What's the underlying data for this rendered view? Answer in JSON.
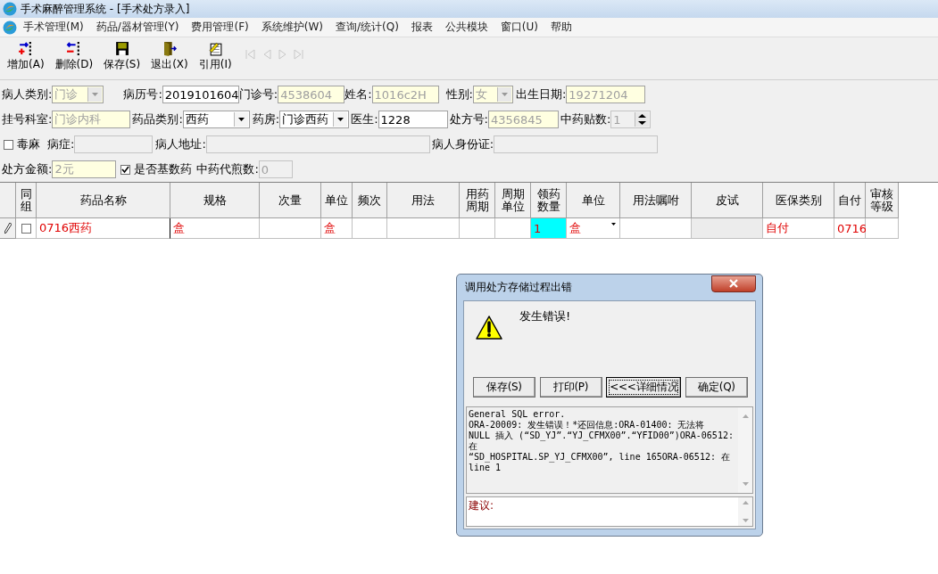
{
  "window": {
    "title": "手术麻醉管理系统 - [手术处方录入]"
  },
  "menu": [
    "手术管理(M)",
    "药品/器材管理(Y)",
    "费用管理(F)",
    "系统维护(W)",
    "查询/统计(Q)",
    "报表",
    "公共模块",
    "窗口(U)",
    "帮助"
  ],
  "toolbar": [
    {
      "kind": "add",
      "label": "增加(A)"
    },
    {
      "kind": "delete",
      "label": "删除(D)"
    },
    {
      "kind": "save",
      "label": "保存(S)"
    },
    {
      "kind": "exit",
      "label": "退出(X)"
    },
    {
      "kind": "cite",
      "label": "引用(I)"
    }
  ],
  "navigator": [
    {
      "kind": "first",
      "disabled": true
    },
    {
      "kind": "prev",
      "disabled": true
    },
    {
      "kind": "next",
      "disabled": true
    },
    {
      "kind": "last",
      "disabled": true
    }
  ],
  "form_rows": [
    [
      {
        "kind": "combo",
        "label": "病人类别:",
        "value": "门诊",
        "readonly": true,
        "disabled": false
      },
      {
        "kind": "text",
        "label": "病历号:",
        "value": "2019101604",
        "readonly": false,
        "disabled": false
      },
      {
        "kind": "text",
        "label": "门诊号:",
        "value": "4538604",
        "readonly": true,
        "disabled": false
      },
      {
        "kind": "text",
        "label": "姓名:",
        "value": "1016c2H",
        "readonly": true,
        "disabled": false
      },
      {
        "kind": "combo",
        "label": "性别:",
        "value": "女",
        "readonly": true,
        "disabled": false
      },
      {
        "kind": "text",
        "label": "出生日期:",
        "value": "19271204",
        "readonly": true,
        "disabled": false
      }
    ],
    [
      {
        "kind": "text",
        "label": "挂号科室:",
        "value": "门诊内科",
        "readonly": true,
        "disabled": false
      },
      {
        "kind": "combo",
        "label": "药品类别:",
        "value": "西药",
        "readonly": false,
        "disabled": false
      },
      {
        "kind": "combo",
        "label": "药房:",
        "value": "门诊西药",
        "readonly": false,
        "disabled": false
      },
      {
        "kind": "text",
        "label": "医生:",
        "value": "1228",
        "readonly": false,
        "disabled": false
      },
      {
        "kind": "text",
        "label": "处方号:",
        "value": "4356845",
        "readonly": true,
        "disabled": false
      },
      {
        "kind": "spin",
        "label": "中药贴数:",
        "value": "1",
        "readonly": false,
        "disabled": true
      }
    ],
    [
      {
        "kind": "checkbox",
        "label": "毒麻",
        "checked": false
      },
      {
        "kind": "text",
        "label": "病症:",
        "readonly": false,
        "disabled": true
      },
      {
        "kind": "text",
        "label": "病人地址:",
        "readonly": false,
        "disabled": true
      },
      {
        "kind": "text",
        "label": "病人身份证:",
        "readonly": false,
        "disabled": true
      }
    ],
    [
      {
        "kind": "text",
        "label": "处方金额:",
        "value": "2元",
        "readonly": true,
        "disabled": false
      },
      {
        "kind": "checkbox",
        "label": "是否基数药",
        "checked": true
      },
      {
        "kind": "text",
        "label": "中药代煎数:",
        "value": "0",
        "readonly": false,
        "disabled": true
      }
    ]
  ],
  "grid": {
    "columns": [
      "同组",
      "药品名称",
      "规格",
      "次量",
      "单位",
      "频次",
      "用法",
      "用药周期",
      "周期单位",
      "领药数量",
      "单位",
      "用法嘱咐",
      "皮试",
      "医保类别",
      "自付",
      "审核等级"
    ],
    "rows": [
      {
        "editing": true,
        "cells": [
          {
            "kind": "checkbox",
            "checked": false,
            "selected": false
          },
          {
            "kind": "text",
            "text": "0716西药",
            "selected": false
          },
          {
            "kind": "text",
            "text": "盒",
            "selected": false
          },
          {
            "kind": "text",
            "selected": false
          },
          {
            "kind": "text",
            "text": "盒",
            "selected": false
          },
          {
            "kind": "text",
            "selected": false
          },
          {
            "kind": "text",
            "selected": false
          },
          {
            "kind": "text",
            "selected": false
          },
          {
            "kind": "text",
            "selected": false
          },
          {
            "kind": "text",
            "text": "1",
            "selected": true
          },
          {
            "kind": "combo",
            "text": "盒",
            "selected": false
          },
          {
            "kind": "text",
            "selected": false
          },
          {
            "kind": "readonly",
            "selected": false
          },
          {
            "kind": "text",
            "text": "自付",
            "selected": false
          },
          {
            "kind": "text",
            "text": "0716",
            "selected": false
          },
          {
            "kind": "text",
            "selected": false
          }
        ]
      }
    ]
  },
  "dialog": {
    "title": "调用处方存储过程出错",
    "message": "发生错误!",
    "buttons": [
      {
        "label": "保存(S)",
        "focused": false
      },
      {
        "label": "打印(P)",
        "focused": false
      },
      {
        "label": "<<<详细情况",
        "focused": true
      },
      {
        "label": "确定(Q)",
        "focused": false
      }
    ],
    "details": [
      "General SQL error.",
      "ORA-20009: 发生错误！*还回信息:ORA-01400: 无法将",
      "NULL 插入 (“SD_YJ”.“YJ_CFMX00”.“YFID00”)ORA-06512:",
      "在",
      "“SD_HOSPITAL.SP_YJ_CFMX00”, line 165ORA-06512: 在",
      "line 1"
    ],
    "suggestion": "建议:"
  }
}
